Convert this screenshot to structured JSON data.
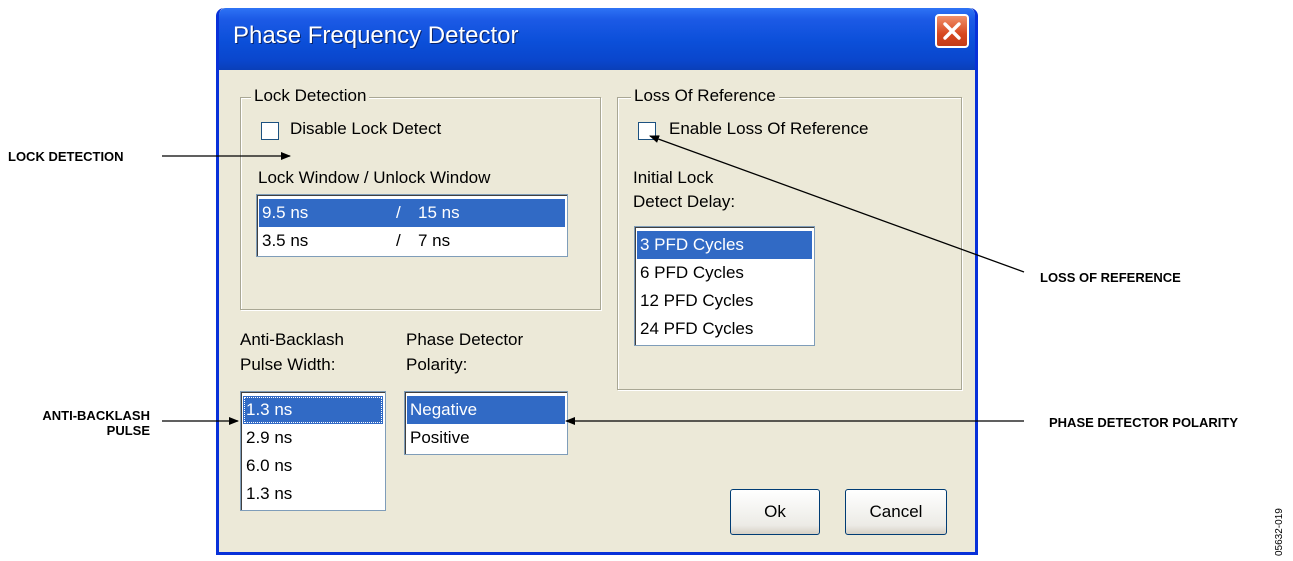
{
  "window": {
    "title": "Phase Frequency Detector"
  },
  "lock_detection": {
    "legend": "Lock Detection",
    "disable_checkbox_label": "Disable Lock Detect",
    "window_label": "Lock Window / Unlock Window",
    "options": [
      {
        "lock": "9.5 ns",
        "sep": "/",
        "unlock": "15 ns",
        "selected": true
      },
      {
        "lock": "3.5 ns",
        "sep": "/",
        "unlock": "7 ns",
        "selected": false
      }
    ]
  },
  "loss_of_reference": {
    "legend": "Loss Of Reference",
    "enable_checkbox_label": "Enable Loss Of Reference",
    "delay_label_line1": "Initial Lock",
    "delay_label_line2": "Detect Delay:",
    "options": [
      "3 PFD Cycles",
      "6 PFD Cycles",
      "12 PFD Cycles",
      "24 PFD Cycles"
    ],
    "selected_index": 0
  },
  "anti_backlash": {
    "label_line1": "Anti-Backlash",
    "label_line2": "Pulse Width:",
    "options": [
      "1.3 ns",
      "2.9 ns",
      "6.0 ns",
      "1.3 ns"
    ],
    "selected_index": 0
  },
  "polarity": {
    "label_line1": "Phase Detector",
    "label_line2": "Polarity:",
    "options": [
      "Negative",
      "Positive"
    ],
    "selected_index": 0
  },
  "buttons": {
    "ok": "Ok",
    "cancel": "Cancel"
  },
  "annotations": {
    "lock_detection": "LOCK DETECTION",
    "loss_of_reference": "LOSS OF REFERENCE",
    "anti_backlash_line1": "ANTI-BACKLASH",
    "anti_backlash_line2": "PULSE",
    "phase_detector_polarity": "PHASE DETECTOR POLARITY"
  },
  "figure_number": "05632-019",
  "colors": {
    "selection": "#316ac5",
    "titlebar": "#0a4fd9",
    "dialog_bg": "#ece9d8",
    "close_button": "#d8481f"
  }
}
